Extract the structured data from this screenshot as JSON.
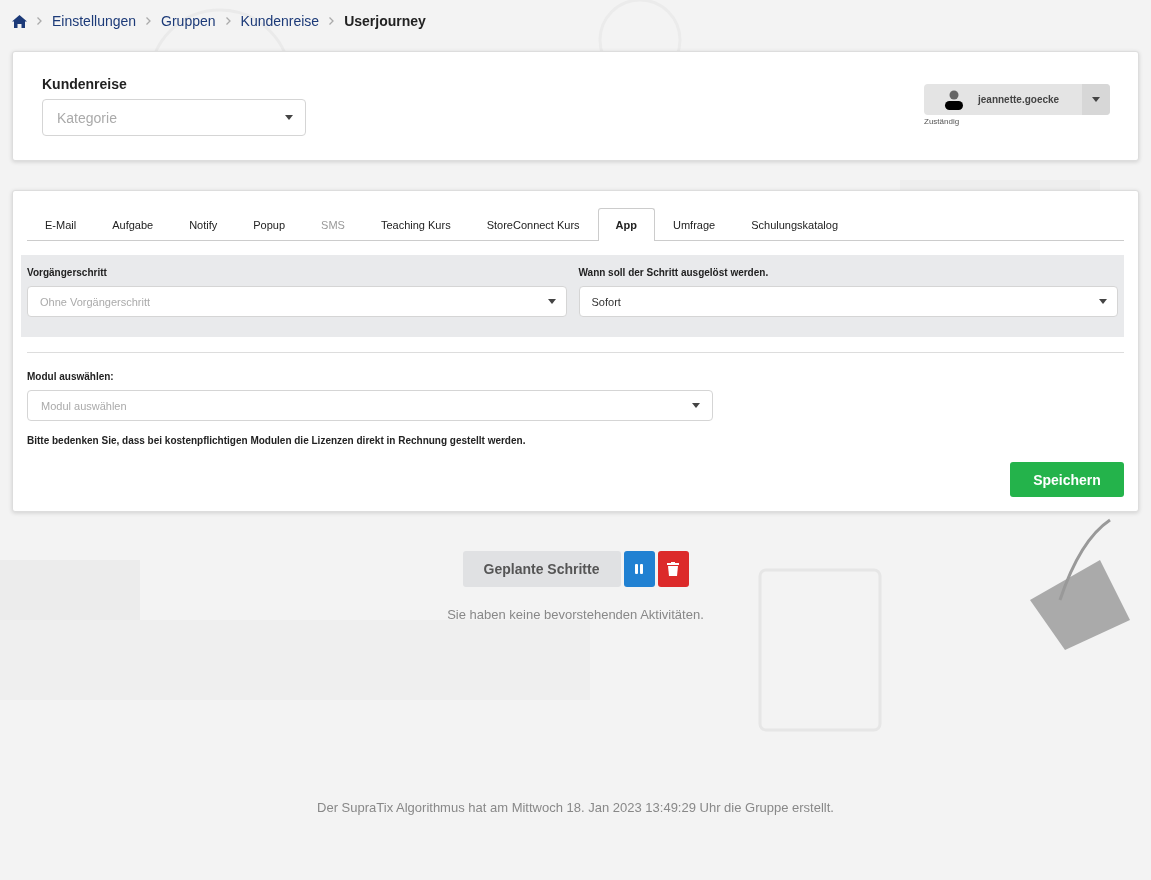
{
  "breadcrumb": {
    "items": [
      {
        "label": "Einstellungen"
      },
      {
        "label": "Gruppen"
      },
      {
        "label": "Kundenreise"
      }
    ],
    "current": "Userjourney"
  },
  "header_card": {
    "title": "Kundenreise",
    "category": {
      "placeholder": "Kategorie"
    },
    "assignee": {
      "name": "jeannette.goecke",
      "caption": "Zuständig"
    }
  },
  "tabs": [
    {
      "label": "E-Mail",
      "selected": false,
      "disabled": false
    },
    {
      "label": "Aufgabe",
      "selected": false,
      "disabled": false
    },
    {
      "label": "Notify",
      "selected": false,
      "disabled": false
    },
    {
      "label": "Popup",
      "selected": false,
      "disabled": false
    },
    {
      "label": "SMS",
      "selected": false,
      "disabled": true
    },
    {
      "label": "Teaching Kurs",
      "selected": false,
      "disabled": false
    },
    {
      "label": "StoreConnect Kurs",
      "selected": false,
      "disabled": false
    },
    {
      "label": "App",
      "selected": true,
      "disabled": false
    },
    {
      "label": "Umfrage",
      "selected": false,
      "disabled": false
    },
    {
      "label": "Schulungskatalog",
      "selected": false,
      "disabled": false
    }
  ],
  "trigger": {
    "predecessor": {
      "label": "Vorgängerschritt",
      "placeholder": "Ohne Vorgängerschritt"
    },
    "timing": {
      "label": "Wann soll der Schritt ausgelöst werden.",
      "value": "Sofort"
    }
  },
  "module": {
    "label": "Modul auswählen:",
    "placeholder": "Modul auswählen",
    "notice": "Bitte bedenken Sie, dass bei kostenpflichtigen Modulen die Lizenzen direkt in Rechnung gestellt werden."
  },
  "save_button": "Speichern",
  "planned": {
    "button": "Geplante Schritte",
    "empty": "Sie haben keine bevorstehenden Aktivitäten."
  },
  "footer": "Der SupraTix Algorithmus hat am Mittwoch 18. Jan 2023 13:49:29 Uhr die Gruppe erstellt."
}
